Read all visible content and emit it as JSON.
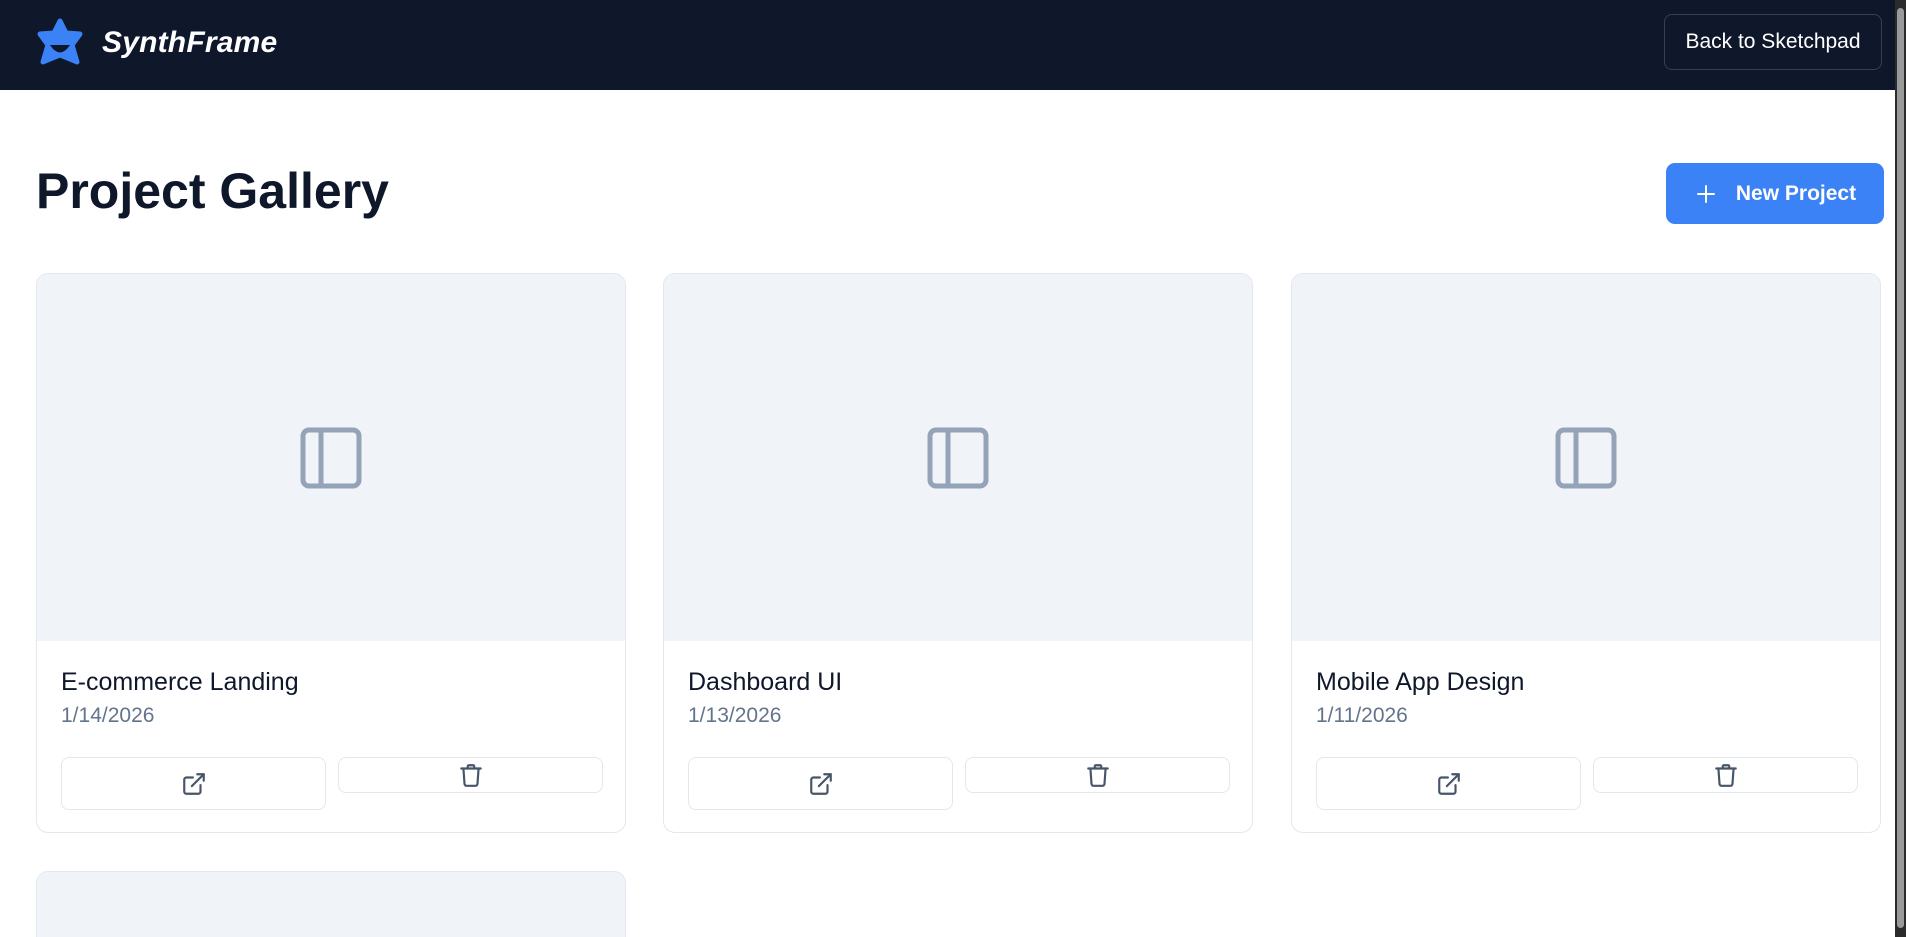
{
  "app": {
    "name": "SynthFrame",
    "logo_icon": "star-logo-icon"
  },
  "header": {
    "back_label": "Back to Sketchpad"
  },
  "page": {
    "title": "Project Gallery",
    "new_project_label": "New Project",
    "new_project_icon": "plus-icon"
  },
  "colors": {
    "header_bg": "#0f172a",
    "accent": "#3b82f6",
    "thumb_bg": "#f0f3f8",
    "muted_text": "#64748b"
  },
  "projects": [
    {
      "name": "E-commerce Landing",
      "date": "1/14/2026",
      "thumb_icon": "panel-left-icon",
      "open_icon": "external-link-icon",
      "delete_icon": "trash-icon"
    },
    {
      "name": "Dashboard UI",
      "date": "1/13/2026",
      "thumb_icon": "panel-left-icon",
      "open_icon": "external-link-icon",
      "delete_icon": "trash-icon"
    },
    {
      "name": "Mobile App Design",
      "date": "1/11/2026",
      "thumb_icon": "panel-left-icon",
      "open_icon": "external-link-icon",
      "delete_icon": "trash-icon"
    },
    {
      "name": "",
      "date": "",
      "thumb_icon": "panel-left-icon"
    }
  ]
}
